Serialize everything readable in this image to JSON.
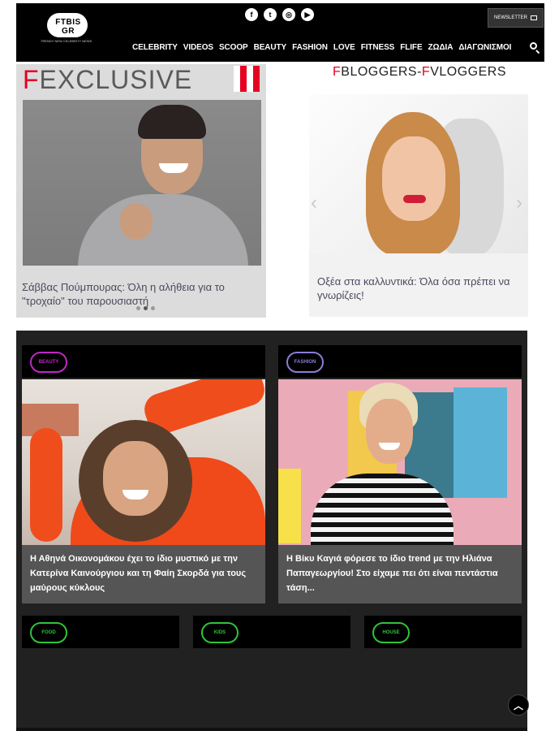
{
  "header": {
    "logo_text": "FTBIS GR",
    "logo_tagline": "TRENDY NEW CELEBRITY NEWS",
    "newsletter_label": "NEWSLETTER",
    "social": [
      {
        "icon": "facebook-icon",
        "glyph": "f"
      },
      {
        "icon": "twitter-icon",
        "glyph": "t"
      },
      {
        "icon": "instagram-icon",
        "glyph": "◎"
      },
      {
        "icon": "youtube-icon",
        "glyph": "▶"
      }
    ],
    "nav": [
      "CELEBRITY",
      "VIDEOS",
      "SCOOP",
      "BEAUTY",
      "FASHION",
      "LOVE",
      "FITNESS",
      "FLIFE",
      "ΖΩΔΙΑ",
      "ΔΙΑΓΩΝΙΣΜΟΙ"
    ]
  },
  "exclusive": {
    "title_first": "F",
    "title_rest": "EXCLUSIVE",
    "caption": "Σάββας Πούμπουρας: Όλη η αλήθεια για το \"τροχαίο\" του παρουσιαστή",
    "flag_colors": [
      "#ffffff",
      "#e60022",
      "#ffffff",
      "#e60022"
    ]
  },
  "bloggers": {
    "title_parts": [
      "F",
      "BLOGGERS-",
      "F",
      "VLOGGERS"
    ],
    "caption": "Οξέα στα καλλυντικά: Όλα όσα πρέπει να γνωρίζεις!"
  },
  "cards": [
    {
      "tag": "BEAUTY",
      "tag_color": "#c026c6",
      "caption": "Η Αθηνά Οικονομάκου έχει το ίδιο μυστικό με την Κατερίνα Καινούργιου και τη Φαίη Σκορδά για τους μαύρους κύκλους"
    },
    {
      "tag": "FASHION",
      "tag_color": "#8a7dd6",
      "caption": "Η Βίκυ Καγιά φόρεσε το ίδιο trend με την Ηλιάνα Παπαγεωργίου! Στο είχαμε πει ότι είναι πεντάστια τάση..."
    }
  ],
  "small_tags": [
    {
      "label": "FOOD",
      "color": "#2ec43a"
    },
    {
      "label": "KIDS",
      "color": "#2ec43a"
    },
    {
      "label": "HOUSE",
      "color": "#2ec43a"
    }
  ],
  "colors": {
    "accent_red": "#e60022",
    "dark_bg": "#212121",
    "header_bg": "#000000"
  }
}
